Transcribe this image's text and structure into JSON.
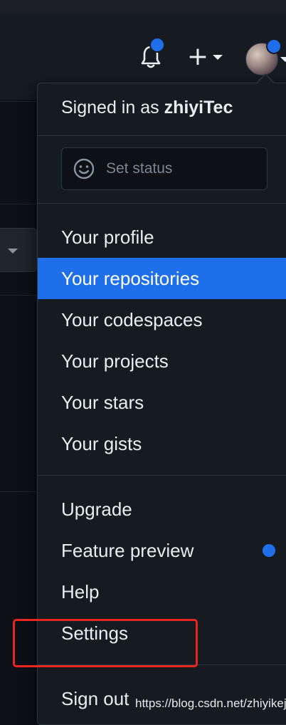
{
  "header": {
    "notifications_icon": "bell-icon",
    "create_icon": "plus-icon",
    "create_symbol": "+",
    "avatar_icon": "avatar"
  },
  "dropdown": {
    "signed_in_prefix": "Signed in as",
    "username": "zhiyiTec",
    "status_placeholder": "Set status",
    "status_icon": "smiley-icon",
    "menu": [
      {
        "label": "Your profile"
      },
      {
        "label": "Your repositories",
        "active": true
      },
      {
        "label": "Your codespaces"
      },
      {
        "label": "Your projects"
      },
      {
        "label": "Your stars"
      },
      {
        "label": "Your gists"
      }
    ],
    "secondary": [
      {
        "label": "Upgrade"
      },
      {
        "label": "Feature preview"
      },
      {
        "label": "Help"
      },
      {
        "label": "Settings"
      }
    ],
    "sign_out": "Sign out"
  },
  "watermark": "https://blog.csdn.net/zhiyikeji",
  "colors": {
    "accent": "#1f6feb",
    "annotation": "#e8261f",
    "background": "#161b22"
  }
}
